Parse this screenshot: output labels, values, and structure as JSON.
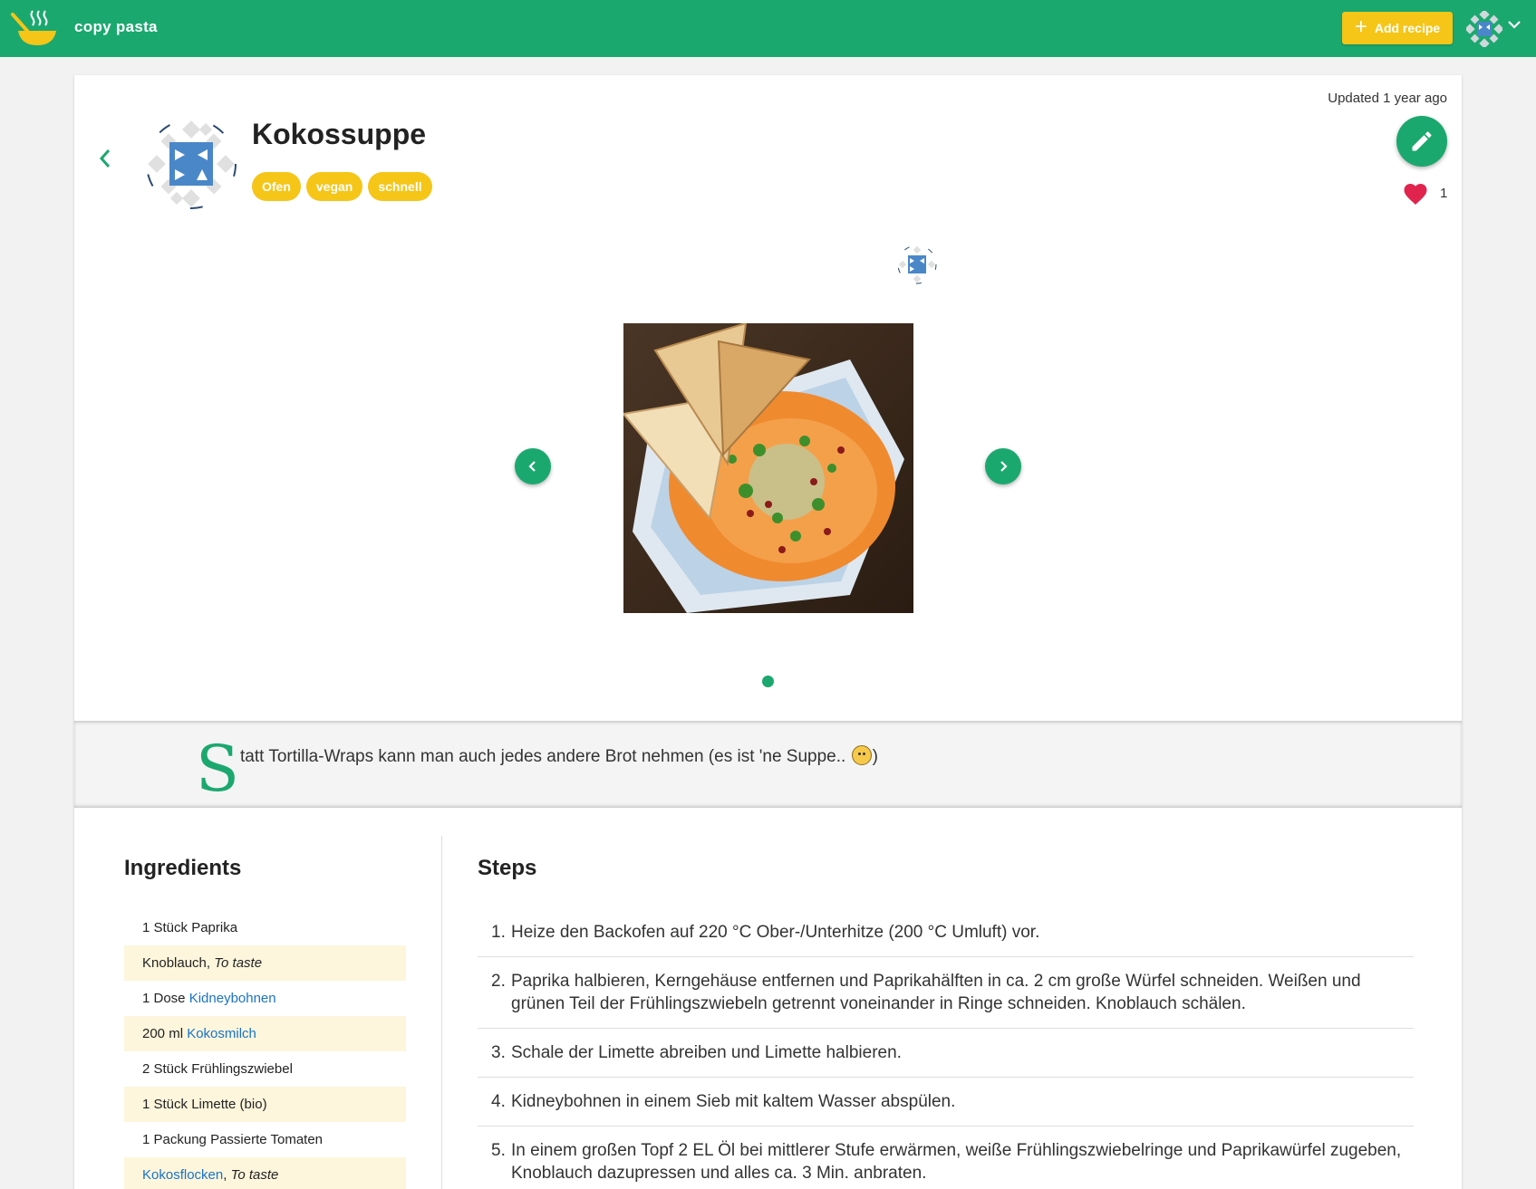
{
  "app": {
    "name": "copy pasta",
    "add_recipe_label": "Add recipe",
    "accent_color": "#1ba86f",
    "tag_color": "#f5c518"
  },
  "recipe": {
    "title": "Kokossuppe",
    "updated": "Updated 1 year ago",
    "tags": [
      "Ofen",
      "vegan",
      "schnell"
    ],
    "likes": "1",
    "note_initial": "S",
    "note_text": "tatt Tortilla-Wraps kann man auch jedes andere Brot nehmen (es ist 'ne Suppe..",
    "note_close": ")",
    "carousel": {
      "current_index": 1,
      "total": 1
    }
  },
  "ingredients": {
    "title": "Ingredients",
    "items": [
      {
        "qty": "1 Stück",
        "name": "Paprika",
        "linked": false,
        "note": ""
      },
      {
        "qty": "",
        "name": "Knoblauch",
        "linked": false,
        "note": "To taste"
      },
      {
        "qty": "1 Dose",
        "name": "Kidneybohnen",
        "linked": true,
        "note": ""
      },
      {
        "qty": "200 ml",
        "name": "Kokosmilch",
        "linked": true,
        "note": ""
      },
      {
        "qty": "2 Stück",
        "name": "Frühlingszwiebel",
        "linked": false,
        "note": ""
      },
      {
        "qty": "1 Stück",
        "name": "Limette (bio)",
        "linked": false,
        "note": ""
      },
      {
        "qty": "1 Packung",
        "name": "Passierte Tomaten",
        "linked": false,
        "note": ""
      },
      {
        "qty": "",
        "name": "Kokosflocken",
        "linked": true,
        "note": "To taste"
      }
    ]
  },
  "steps": {
    "title": "Steps",
    "items": [
      "Heize den Backofen auf 220 °C Ober-/Unterhitze (200 °C Umluft) vor.",
      "Paprika halbieren, Kerngehäuse entfernen und Paprikahälften in ca. 2 cm große Würfel schneiden. Weißen und grünen Teil der Frühlingszwiebeln getrennt voneinander in Ringe schneiden. Knoblauch schälen.",
      "Schale der Limette abreiben und Limette halbieren.",
      "Kidneybohnen in einem Sieb mit kaltem Wasser abspülen.",
      "In einem großen Topf 2 EL Öl bei mittlerer Stufe erwärmen, weiße Frühlingszwiebelringe und Paprikawürfel zugeben, Knoblauch dazupressen und alles ca. 3 Min. anbraten."
    ]
  },
  "icons": [
    "soup-bowl-icon",
    "plus-icon",
    "chevron-down-icon",
    "chevron-left-icon",
    "pencil-icon",
    "heart-icon",
    "chevron-right-icon"
  ]
}
